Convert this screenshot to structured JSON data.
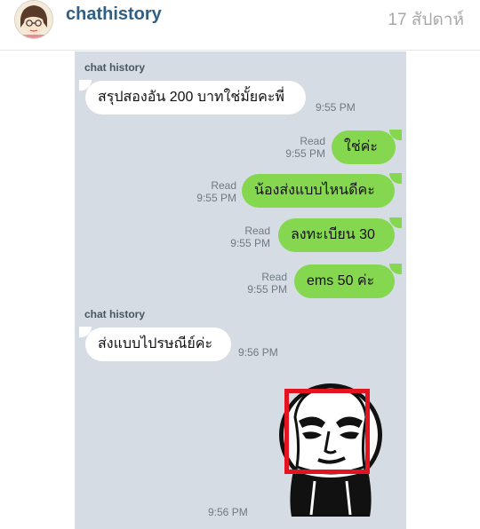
{
  "header": {
    "username": "chathistory",
    "timestamp": "17 สัปดาห์",
    "avatar_icon": "cartoon-girl-avatar-icon"
  },
  "chat": {
    "messages": [
      {
        "sender": "chat history",
        "text": "สรุปสองอัน 200 บาทใช่มั้ยคะพี่",
        "time": "9:55 PM",
        "direction": "in"
      },
      {
        "text": "ใช่ค่ะ",
        "read": "Read",
        "time": "9:55 PM",
        "direction": "out"
      },
      {
        "text": "น้องส่งแบบไหนดีคะ",
        "read": "Read",
        "time": "9:55 PM",
        "direction": "out"
      },
      {
        "text": "ลงทะเบียน 30",
        "read": "Read",
        "time": "9:55 PM",
        "direction": "out"
      },
      {
        "text": "ems 50 ค่ะ",
        "read": "Read",
        "time": "9:55 PM",
        "direction": "out"
      },
      {
        "sender": "chat history",
        "text": "ส่งแบบไปรษณีย์ค่ะ",
        "time": "9:56 PM",
        "direction": "in"
      }
    ],
    "sticker": {
      "icon": "face-sticker-icon",
      "time": "9:56 PM",
      "highlight_color": "#e3131f"
    }
  },
  "colors": {
    "chat_background": "#d5dce4",
    "outgoing_bubble": "#86d750",
    "incoming_bubble": "#ffffff",
    "username": "#2f5f85"
  }
}
